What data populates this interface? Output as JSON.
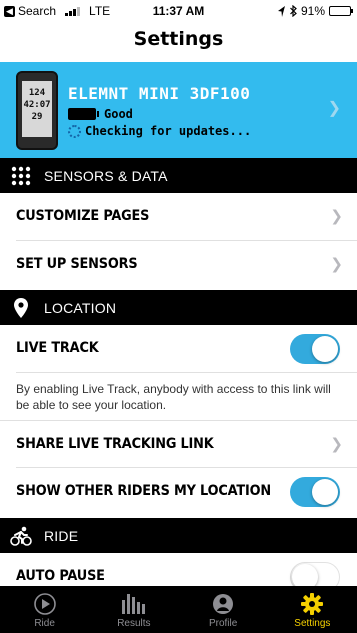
{
  "status_bar": {
    "back_label": "Search",
    "carrier": "LTE",
    "time": "11:37 AM",
    "battery_percent": "91%",
    "battery_level": 0.91
  },
  "header": {
    "title": "Settings"
  },
  "device": {
    "name": "ELEMNT MINI 3DF100",
    "battery_status": "Good",
    "update_status": "Checking for updates...",
    "screen_line1": "124",
    "screen_line2": "42:07",
    "screen_line3": "29"
  },
  "sections": {
    "sensors": {
      "title": "SENSORS & DATA",
      "items": [
        {
          "label": "CUSTOMIZE PAGES"
        },
        {
          "label": "SET UP SENSORS"
        }
      ]
    },
    "location": {
      "title": "LOCATION",
      "live_track_label": "LIVE TRACK",
      "live_track_on": true,
      "description": "By enabling Live Track, anybody with access to this link will be able to see your location.",
      "share_link_label": "SHARE LIVE TRACKING LINK",
      "show_riders_label": "SHOW OTHER RIDERS MY LOCATION",
      "show_riders_on": true
    },
    "ride": {
      "title": "RIDE",
      "auto_pause_label": "AUTO PAUSE",
      "auto_pause_on": false
    }
  },
  "tab_bar": {
    "tabs": [
      {
        "label": "Ride",
        "icon": "play-circle-icon",
        "active": false
      },
      {
        "label": "Results",
        "icon": "bar-chart-icon",
        "active": false
      },
      {
        "label": "Profile",
        "icon": "profile-icon",
        "active": false
      },
      {
        "label": "Settings",
        "icon": "gear-icon",
        "active": true
      }
    ]
  },
  "colors": {
    "accent_blue": "#33bbee",
    "toggle_on": "#33aadd",
    "active_tab": "#f5d000",
    "section_header": "#000000"
  }
}
